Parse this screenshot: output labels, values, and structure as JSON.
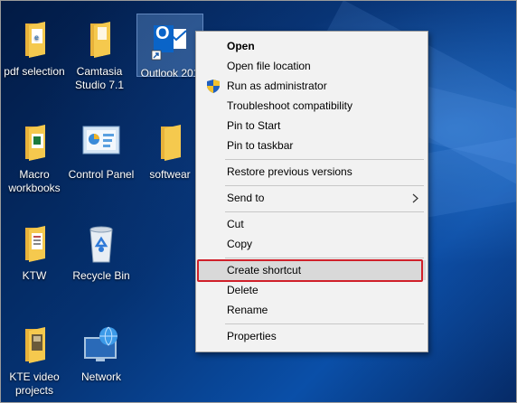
{
  "desktop": {
    "icons": [
      {
        "id": "pdf-selection",
        "label": "pdf selection",
        "type": "folder-doc"
      },
      {
        "id": "camtasia",
        "label": "Camtasia Studio 7.1",
        "type": "folder"
      },
      {
        "id": "outlook",
        "label": "Outlook 201",
        "type": "outlook"
      },
      {
        "id": "macro",
        "label": "Macro workbooks",
        "type": "folder-excel"
      },
      {
        "id": "control-panel",
        "label": "Control Panel",
        "type": "control-panel"
      },
      {
        "id": "softwear",
        "label": "softwear",
        "type": "folder"
      },
      {
        "id": "ktw",
        "label": "KTW",
        "type": "folder-doc"
      },
      {
        "id": "recycle",
        "label": "Recycle Bin",
        "type": "recycle-bin"
      },
      {
        "id": "kte",
        "label": "KTE video projects",
        "type": "folder-doc"
      },
      {
        "id": "network",
        "label": "Network",
        "type": "network"
      }
    ],
    "outlook_letter": "O"
  },
  "context_menu": {
    "items": [
      {
        "label": "Open"
      },
      {
        "label": "Open file location"
      },
      {
        "label": "Run as administrator"
      },
      {
        "label": "Troubleshoot compatibility"
      },
      {
        "label": "Pin to Start"
      },
      {
        "label": "Pin to taskbar"
      },
      {
        "label": "Restore previous versions"
      },
      {
        "label": "Send to"
      },
      {
        "label": "Cut"
      },
      {
        "label": "Copy"
      },
      {
        "label": "Create shortcut"
      },
      {
        "label": "Delete"
      },
      {
        "label": "Rename"
      },
      {
        "label": "Properties"
      }
    ],
    "highlighted": "Create shortcut"
  },
  "colors": {
    "highlight_border": "#d0202a",
    "folder_yellow": "#f5c94e",
    "outlook_blue": "#0a64c8"
  }
}
